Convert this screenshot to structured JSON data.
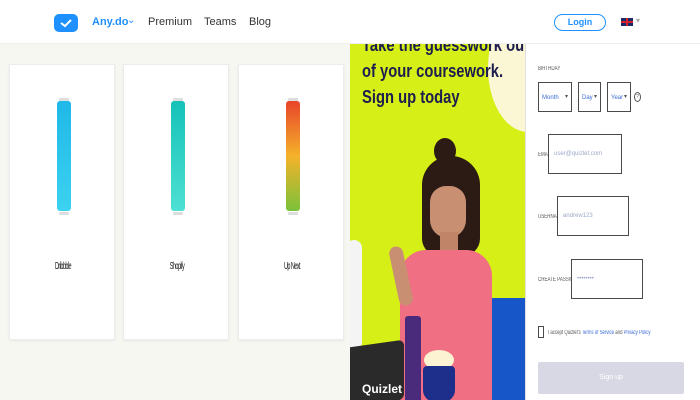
{
  "header": {
    "brand": "Any.do",
    "nav": [
      "Premium",
      "Teams",
      "Blog"
    ],
    "login": "Login"
  },
  "apps": [
    {
      "label": "Dribbble",
      "accent": "#1fb8e8"
    },
    {
      "label": "Shopify",
      "accent": "#15c2b8"
    },
    {
      "label": "Up Next",
      "accent": "#e8442a"
    }
  ],
  "promo": {
    "lines": [
      "Take the guesswork out",
      "of your coursework.",
      "Sign up today"
    ],
    "brand": "Quizlet",
    "bg_color": "#d6ef17"
  },
  "form": {
    "birthday_label": "BIRTHDAY",
    "month": "Month",
    "day": "Day",
    "year": "Year",
    "email_label": "EMAIL",
    "email_placeholder": "user@quizlet.com",
    "username_label": "USERNAME",
    "username_placeholder": "andrew123",
    "password_label": "CREATE PASSWORD",
    "password_placeholder": "••••••••",
    "terms_prefix": "I accept Quizlet's",
    "terms_link": "Terms of Service",
    "terms_and": "and",
    "privacy_link": "Privacy Policy",
    "signup": "Sign up"
  }
}
